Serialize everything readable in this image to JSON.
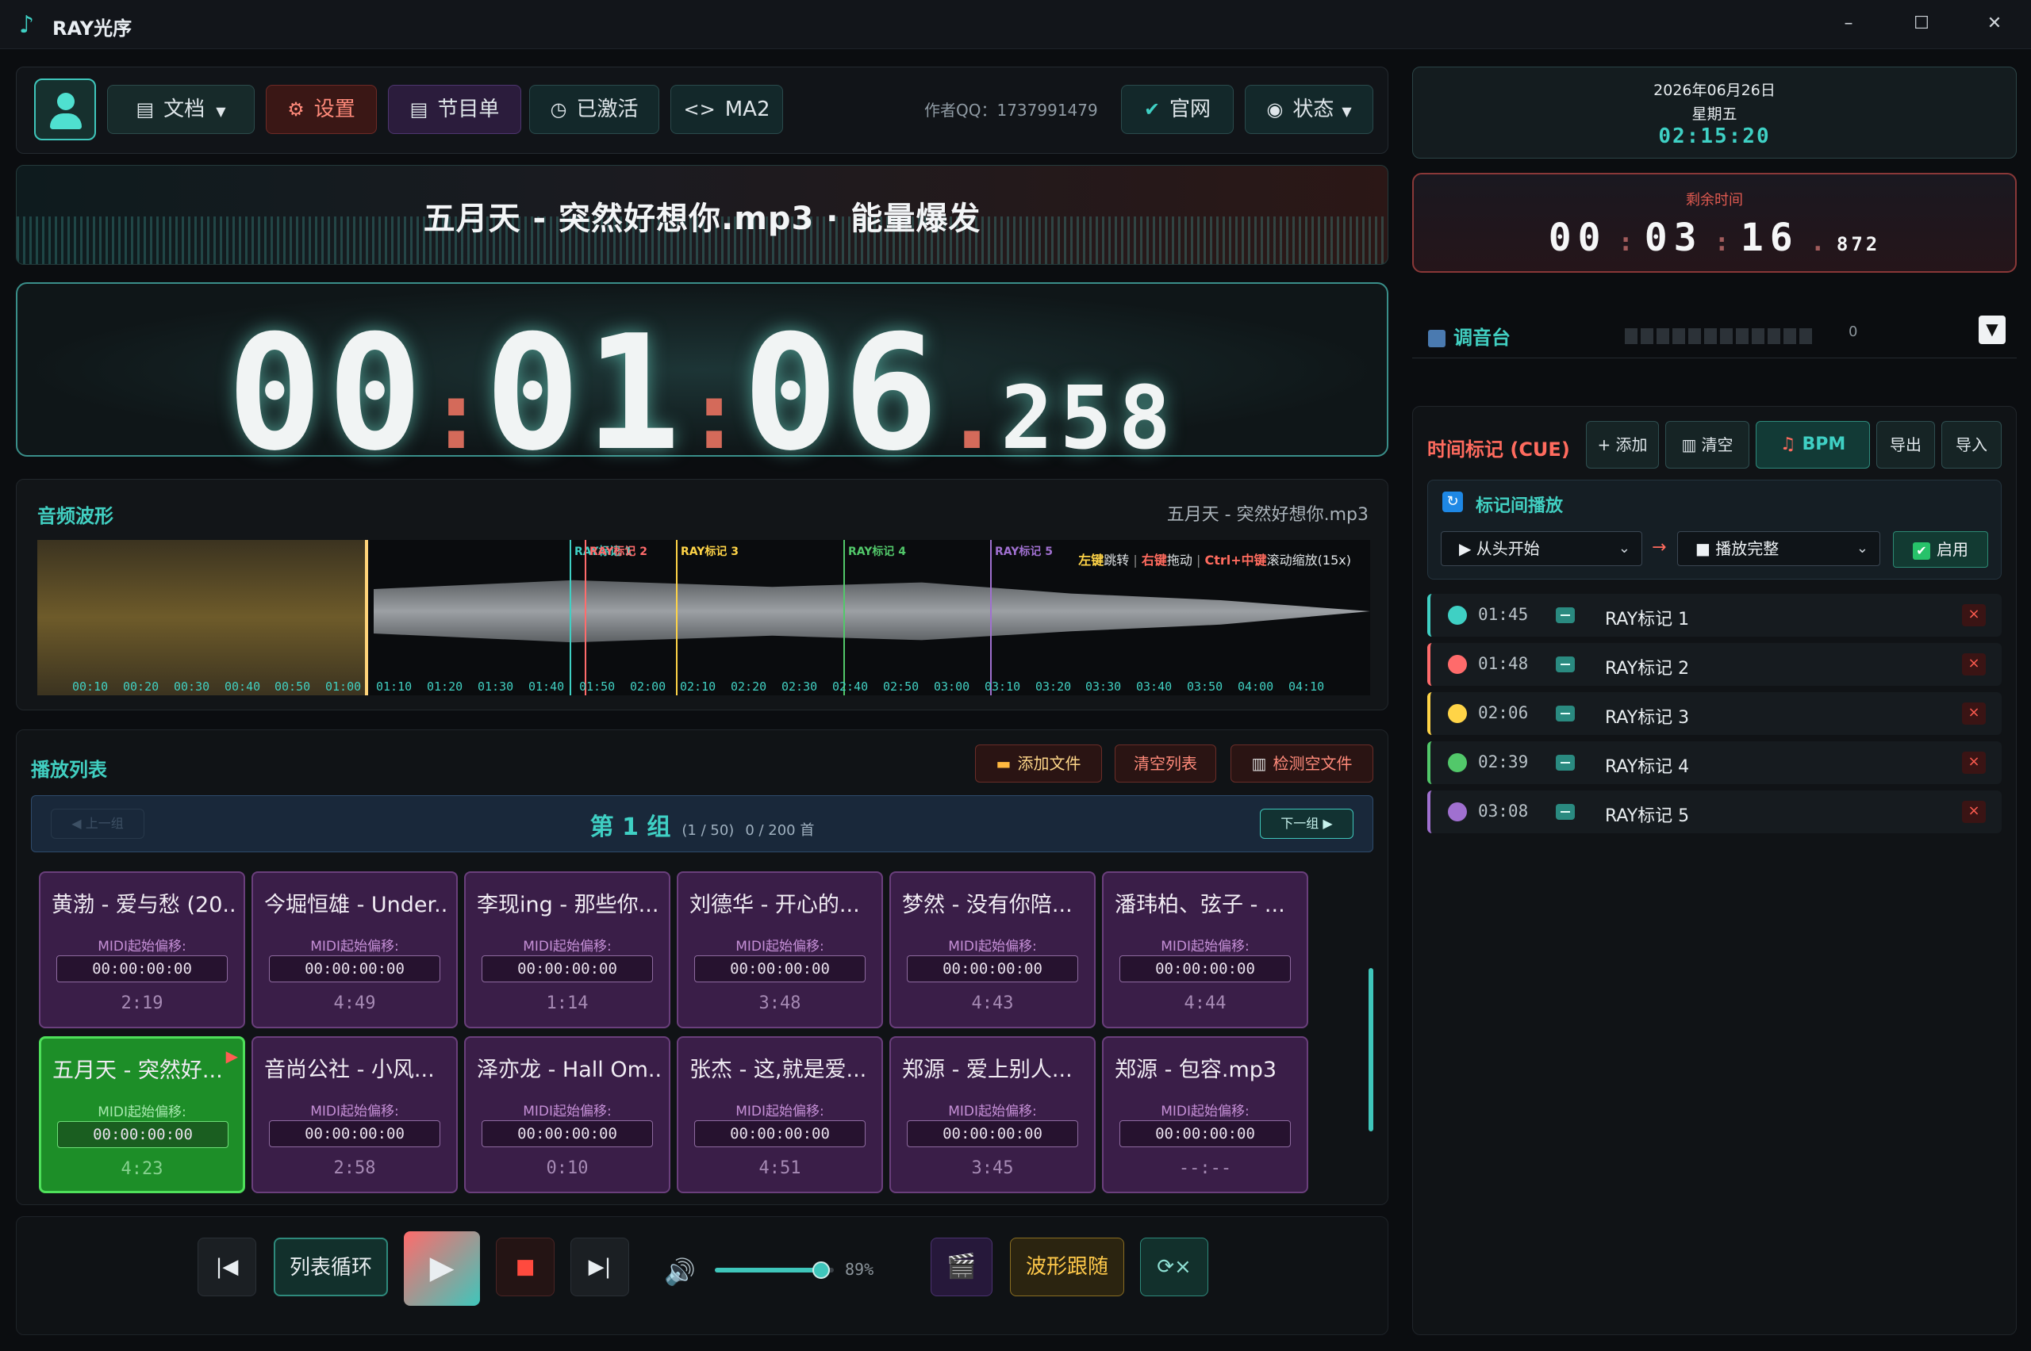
{
  "app": {
    "title": "RAY光序"
  },
  "window": {
    "minimize": "–",
    "maximize": "☐",
    "close": "✕"
  },
  "toolbar": {
    "docs": "文档",
    "settings": "设置",
    "program": "节目单",
    "activated": "已激活",
    "ma2": "MA2",
    "author": "作者QQ：1737991479",
    "website": "官网",
    "status": "状态"
  },
  "now_playing": {
    "title": "五月天 - 突然好想你.mp3 · 能量爆发"
  },
  "timer": {
    "hh": "00",
    "mm": "01",
    "ss": "06",
    "ms": "258"
  },
  "waveform": {
    "label": "音频波形",
    "filename": "五月天 - 突然好想你.mp3",
    "progress_fraction": 0.246,
    "hint_left": "左键",
    "hint_left_action": "跳转",
    "hint_right": "右键",
    "hint_right_action": "拖动",
    "hint_ctrl": "Ctrl+中键",
    "hint_ctrl_action": "滚动缩放(15x)",
    "markers": [
      {
        "label": "RAY标记 1",
        "time_s": 105,
        "color": "#3fd0c4"
      },
      {
        "label": "RAY标记 2",
        "time_s": 108,
        "color": "#ff6b6b"
      },
      {
        "label": "RAY标记 3",
        "time_s": 126,
        "color": "#ffd447"
      },
      {
        "label": "RAY标记 4",
        "time_s": 159,
        "color": "#52c86a"
      },
      {
        "label": "RAY标记 5",
        "time_s": 188,
        "color": "#a070d0"
      }
    ],
    "ticks": [
      "00:10",
      "00:20",
      "00:30",
      "00:40",
      "00:50",
      "01:00",
      "01:10",
      "01:20",
      "01:30",
      "01:40",
      "01:50",
      "02:00",
      "02:10",
      "02:20",
      "02:30",
      "02:40",
      "02:50",
      "03:00",
      "03:10",
      "03:20",
      "03:30",
      "03:40",
      "03:50",
      "04:00",
      "04:10"
    ]
  },
  "playlist": {
    "label": "播放列表",
    "add_files": "添加文件",
    "clear_list": "清空列表",
    "detect_empty": "检测空文件",
    "prev_group": "◀ 上一组",
    "next_group": "下一组 ▶",
    "group_title": "第 1 组",
    "group_page": "(1 / 50)",
    "group_count": "0 / 200 首",
    "offset_label": "MIDI起始偏移:",
    "items": [
      {
        "title": "黄渤 - 爱与愁 (20...",
        "offset": "00:00:00:00",
        "duration": "2:19"
      },
      {
        "title": "今堀恒雄 - Under...",
        "offset": "00:00:00:00",
        "duration": "4:49"
      },
      {
        "title": "李现ing - 那些你...",
        "offset": "00:00:00:00",
        "duration": "1:14"
      },
      {
        "title": "刘德华 - 开心的...",
        "offset": "00:00:00:00",
        "duration": "3:48"
      },
      {
        "title": "梦然 - 没有你陪...",
        "offset": "00:00:00:00",
        "duration": "4:43"
      },
      {
        "title": "潘玮柏、弦子 - ...",
        "offset": "00:00:00:00",
        "duration": "4:44"
      },
      {
        "title": "五月天 - 突然好...",
        "offset": "00:00:00:00",
        "duration": "4:23"
      },
      {
        "title": "音尚公社 - 小风...",
        "offset": "00:00:00:00",
        "duration": "2:58"
      },
      {
        "title": "泽亦龙 - Hall Om...",
        "offset": "00:00:00:00",
        "duration": "0:10"
      },
      {
        "title": "张杰 - 这,就是爱...",
        "offset": "00:00:00:00",
        "duration": "4:51"
      },
      {
        "title": "郑源 - 爱上别人...",
        "offset": "00:00:00:00",
        "duration": "3:45"
      },
      {
        "title": "郑源 - 包容.mp3",
        "offset": "00:00:00:00",
        "duration": "--:--"
      }
    ]
  },
  "transport": {
    "loop_mode": "列表循环",
    "volume_percent": 89,
    "volume_text": "89%",
    "wave_follow": "波形跟随",
    "speed": "⟳×"
  },
  "datetime": {
    "date": "2026年06月26日",
    "weekday": "星期五",
    "time": "02:15:20"
  },
  "remaining": {
    "label": "剩余时间",
    "hh": "00",
    "mm": "03",
    "ss": "16",
    "ms": "872"
  },
  "mixer": {
    "label": "调音台",
    "value": "0"
  },
  "cue": {
    "label": "时间标记 (CUE)",
    "add": "+ 添加",
    "clear": "清空",
    "bpm": "BPM",
    "export": "导出",
    "import": "导入",
    "loop_title": "标记间播放",
    "from": "从头开始",
    "to": "播放完整",
    "enable": "启用",
    "items": [
      {
        "time": "01:45",
        "name": "RAY标记 1",
        "color": "#3fd0c4"
      },
      {
        "time": "01:48",
        "name": "RAY标记 2",
        "color": "#ff6b6b"
      },
      {
        "time": "02:06",
        "name": "RAY标记 3",
        "color": "#ffd447"
      },
      {
        "time": "02:39",
        "name": "RAY标记 4",
        "color": "#52c86a"
      },
      {
        "time": "03:08",
        "name": "RAY标记 5",
        "color": "#a070d0"
      }
    ]
  }
}
